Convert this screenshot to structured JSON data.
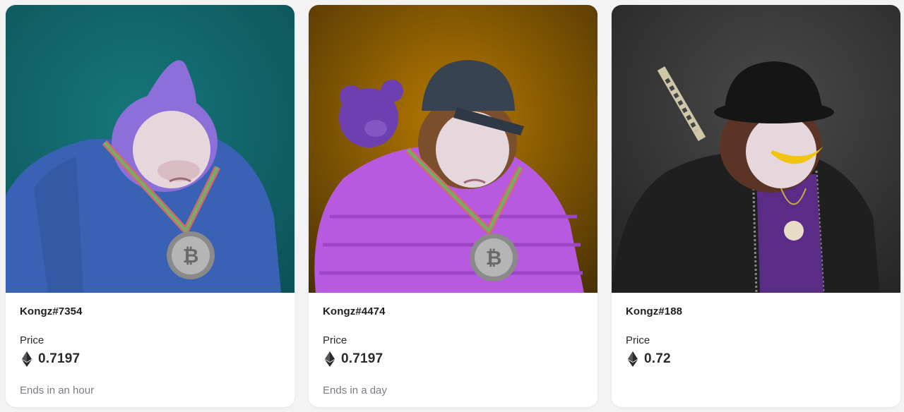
{
  "price_label": "Price",
  "cards": [
    {
      "name": "Kongz#7354",
      "price": "0.7197",
      "ends": "Ends in an hour",
      "bg_color": "#0f6f72",
      "hoodie_color": "#3a62b4",
      "hair_color": "#8d6fd9"
    },
    {
      "name": "Kongz#4474",
      "price": "0.7197",
      "ends": "Ends in a day",
      "bg_color": "#b06f00",
      "hoodie_color": "#b75adf",
      "cap_color": "#384352",
      "bear_color": "#6d3fb0"
    },
    {
      "name": "Kongz#188",
      "price": "0.72",
      "ends": "",
      "bg_color": "#3a3a3a",
      "hoodie_color": "#1f1f1f",
      "shirt_color": "#5a2c86",
      "hat_color": "#151515"
    }
  ],
  "icons": {
    "currency": "ethereum-icon"
  }
}
